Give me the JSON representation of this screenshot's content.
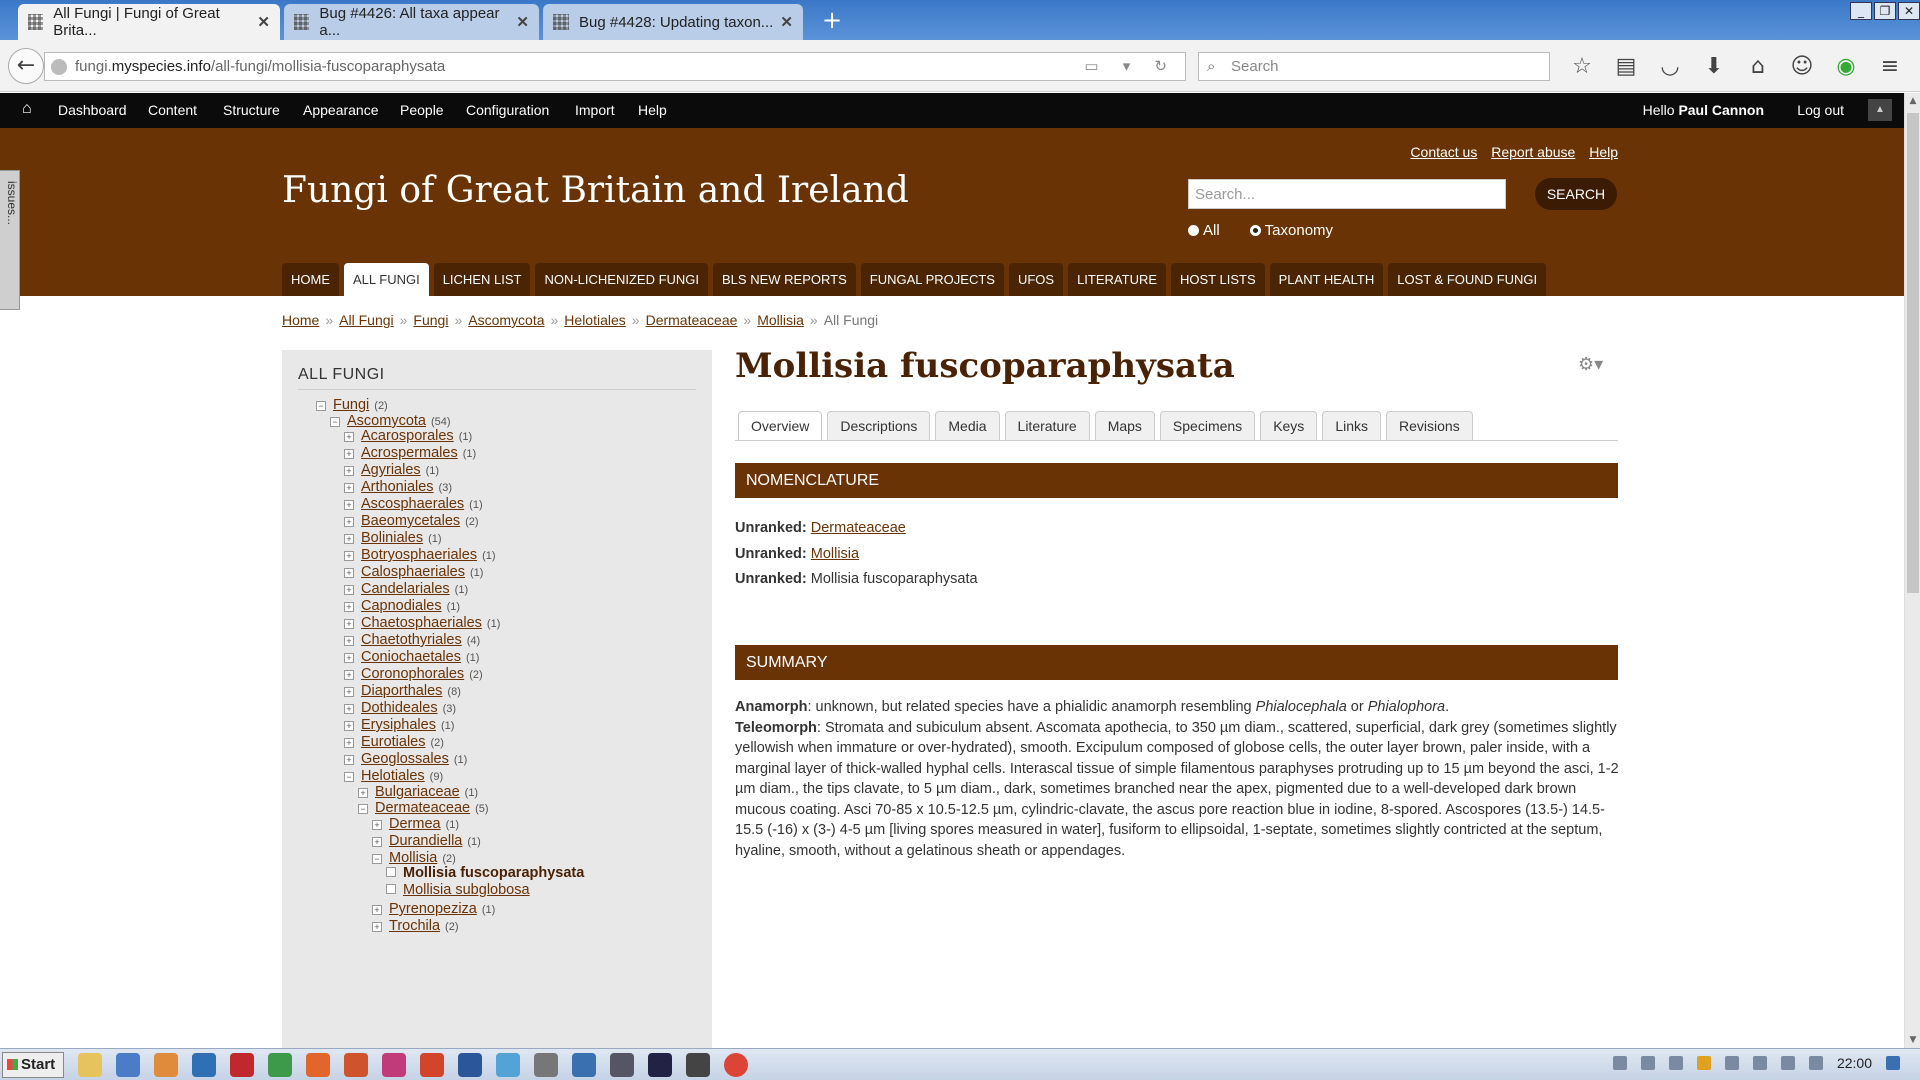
{
  "browser": {
    "tabs": [
      {
        "title": "All Fungi | Fungi of Great Brita...",
        "active": true
      },
      {
        "title": "Bug #4426: All taxa appear a...",
        "active": false
      },
      {
        "title": "Bug #4428: Updating taxon...",
        "active": false
      }
    ],
    "url_prefix": "fungi.",
    "url_domain": "myspecies.info",
    "url_path": "/all-fungi/mollisia-fuscoparaphysata",
    "search_placeholder": "Search"
  },
  "admin_toolbar": {
    "items": [
      "Dashboard",
      "Content",
      "Structure",
      "Appearance",
      "People",
      "Configuration",
      "Import",
      "Help"
    ],
    "hello_prefix": "Hello ",
    "user_name": "Paul Cannon",
    "logout": "Log out"
  },
  "header": {
    "top_links": [
      "Contact us",
      "Report abuse",
      "Help"
    ],
    "site_title": "Fungi of Great Britain and Ireland",
    "search_placeholder": "Search...",
    "search_button": "SEARCH",
    "radio_all": "All",
    "radio_taxonomy": "Taxonomy",
    "nav": [
      "HOME",
      "ALL FUNGI",
      "LICHEN LIST",
      "NON-LICHENIZED FUNGI",
      "BLS NEW REPORTS",
      "FUNGAL PROJECTS",
      "UFOS",
      "LITERATURE",
      "HOST LISTS",
      "PLANT HEALTH",
      "LOST & FOUND FUNGI"
    ],
    "nav_active": "ALL FUNGI"
  },
  "breadcrumb": {
    "links": [
      "Home",
      "All Fungi",
      "Fungi",
      "Ascomycota",
      "Helotiales",
      "Dermateaceae",
      "Mollisia"
    ],
    "current": "All Fungi"
  },
  "sidebar": {
    "title": "ALL FUNGI",
    "tree": [
      {
        "label": "Fungi",
        "count": "(2)",
        "depth": 0,
        "toggle": "−"
      },
      {
        "label": "Ascomycota",
        "count": "(54)",
        "depth": 1,
        "toggle": "−"
      },
      {
        "label": "Acarosporales",
        "count": "(1)",
        "depth": 2,
        "toggle": "+"
      },
      {
        "label": "Acrospermales",
        "count": "(1)",
        "depth": 2,
        "toggle": "+"
      },
      {
        "label": "Agyriales",
        "count": "(1)",
        "depth": 2,
        "toggle": "+"
      },
      {
        "label": "Arthoniales",
        "count": "(3)",
        "depth": 2,
        "toggle": "+"
      },
      {
        "label": "Ascosphaerales",
        "count": "(1)",
        "depth": 2,
        "toggle": "+"
      },
      {
        "label": "Baeomycetales",
        "count": "(2)",
        "depth": 2,
        "toggle": "+"
      },
      {
        "label": "Boliniales",
        "count": "(1)",
        "depth": 2,
        "toggle": "+"
      },
      {
        "label": "Botryosphaeriales",
        "count": "(1)",
        "depth": 2,
        "toggle": "+"
      },
      {
        "label": "Calosphaeriales",
        "count": "(1)",
        "depth": 2,
        "toggle": "+"
      },
      {
        "label": "Candelariales",
        "count": "(1)",
        "depth": 2,
        "toggle": "+"
      },
      {
        "label": "Capnodiales",
        "count": "(1)",
        "depth": 2,
        "toggle": "+"
      },
      {
        "label": "Chaetosphaeriales",
        "count": "(1)",
        "depth": 2,
        "toggle": "+"
      },
      {
        "label": "Chaetothyriales",
        "count": "(4)",
        "depth": 2,
        "toggle": "+"
      },
      {
        "label": "Coniochaetales",
        "count": "(1)",
        "depth": 2,
        "toggle": "+"
      },
      {
        "label": "Coronophorales",
        "count": "(2)",
        "depth": 2,
        "toggle": "+"
      },
      {
        "label": "Diaporthales",
        "count": "(8)",
        "depth": 2,
        "toggle": "+"
      },
      {
        "label": "Dothideales",
        "count": "(3)",
        "depth": 2,
        "toggle": "+"
      },
      {
        "label": "Erysiphales",
        "count": "(1)",
        "depth": 2,
        "toggle": "+"
      },
      {
        "label": "Eurotiales",
        "count": "(2)",
        "depth": 2,
        "toggle": "+"
      },
      {
        "label": "Geoglossales",
        "count": "(1)",
        "depth": 2,
        "toggle": "+"
      },
      {
        "label": "Helotiales",
        "count": "(9)",
        "depth": 2,
        "toggle": "−"
      },
      {
        "label": "Bulgariaceae",
        "count": "(1)",
        "depth": 3,
        "toggle": "+"
      },
      {
        "label": "Dermateaceae",
        "count": "(5)",
        "depth": 3,
        "toggle": "−"
      },
      {
        "label": "Dermea",
        "count": "(1)",
        "depth": 4,
        "toggle": "+"
      },
      {
        "label": "Durandiella",
        "count": "(1)",
        "depth": 4,
        "toggle": "+"
      },
      {
        "label": "Mollisia",
        "count": "(2)",
        "depth": 4,
        "toggle": "−"
      },
      {
        "label": "Mollisia fuscoparaphysata",
        "count": "",
        "depth": 5,
        "toggle": "",
        "current": true
      },
      {
        "label": "Mollisia subglobosa",
        "count": "",
        "depth": 5,
        "toggle": ""
      },
      {
        "label": "Pyrenopeziza",
        "count": "(1)",
        "depth": 4,
        "toggle": "+"
      },
      {
        "label": "Trochila",
        "count": "(2)",
        "depth": 4,
        "toggle": "+"
      }
    ]
  },
  "main": {
    "title": "Mollisia fuscoparaphysata",
    "tabs": [
      "Overview",
      "Descriptions",
      "Media",
      "Literature",
      "Maps",
      "Specimens",
      "Keys",
      "Links",
      "Revisions"
    ],
    "tab_active": "Overview",
    "nomenclature_title": "NOMENCLATURE",
    "nomenclature": [
      {
        "rank": "Unranked:",
        "name": "Dermateaceae",
        "link": true
      },
      {
        "rank": "Unranked:",
        "name": "Mollisia",
        "link": true
      },
      {
        "rank": "Unranked:",
        "name": "Mollisia fuscoparaphysata",
        "link": false
      }
    ],
    "summary_title": "SUMMARY",
    "summary": {
      "anamorph_label": "Anamorph",
      "anamorph_text_1": ": unknown, but related species have a phialidic anamorph resembling ",
      "anamorph_genus_1": "Phialocephala",
      "anamorph_text_2": " or ",
      "anamorph_genus_2": "Phialophora",
      "anamorph_text_3": ".",
      "teleomorph_label": "Teleomorph",
      "teleomorph_text": ": Stromata and subiculum absent. Ascomata apothecia, to 350 µm diam., scattered, superficial, dark grey (sometimes slightly yellowish when immature or over-hydrated), smooth. Excipulum composed of globose cells, the outer layer brown, paler inside, with a marginal layer of thick-walled hyphal cells. Interascal tissue of simple filamentous paraphyses protruding up to 15 µm beyond the asci, 1-2 µm diam., the tips clavate, to 5 µm diam., dark, sometimes branched near the apex, pigmented due to a well-developed dark brown mucous coating. Asci 70-85 x 10.5-12.5 µm, cylindric-clavate, the ascus pore reaction blue in iodine, 8-spored. Ascospores (13.5-) 14.5-15.5 (-16) x (3-) 4-5 µm [living spores measured in water], fusiform to ellipsoidal, 1-septate, sometimes slightly contricted at the septum, hyaline, smooth, without a gelatinous sheath or appendages."
    }
  },
  "issues_tab": "issues...",
  "taskbar": {
    "start": "Start",
    "clock": "22:00"
  },
  "colors": {
    "brand_brown": "#6a3306",
    "dark_brown": "#4b2404",
    "toolbar": "#0b0b0b"
  }
}
